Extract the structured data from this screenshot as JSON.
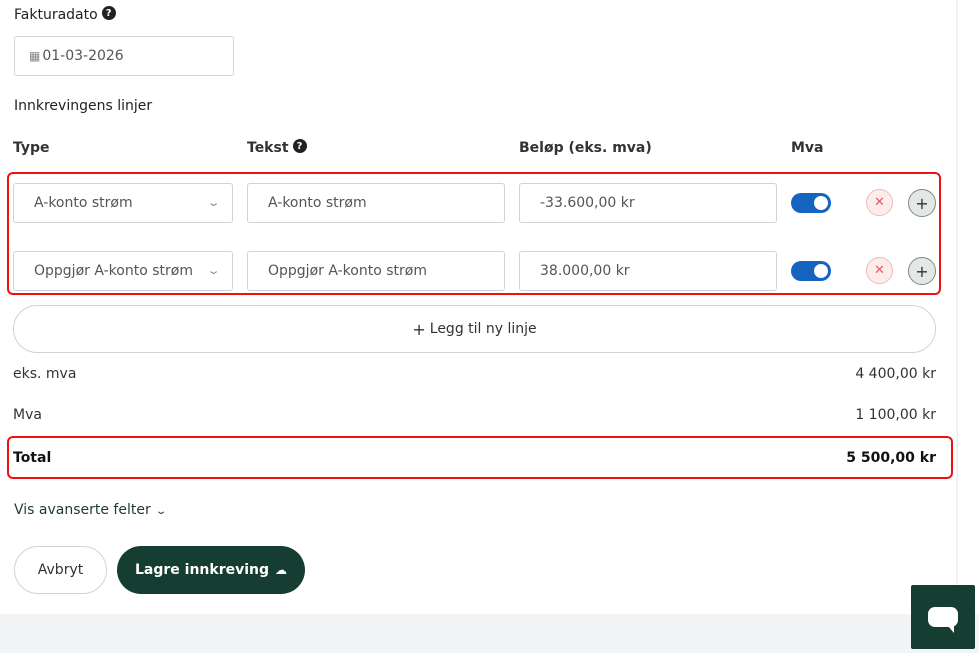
{
  "invoice_date": {
    "label": "Fakturadato",
    "value": "01-03-2026"
  },
  "lines_title": "Innkrevingens linjer",
  "columns": {
    "type": "Type",
    "text": "Tekst",
    "amount": "Beløp (eks. mva)",
    "vat": "Mva"
  },
  "lines": [
    {
      "type": "A-konto strøm",
      "text": "A-konto strøm",
      "amount": "-33.600,00 kr",
      "vat_on": true
    },
    {
      "type": "Oppgjør A-konto strøm",
      "text": "Oppgjør A-konto strøm",
      "amount": "38.000,00 kr",
      "vat_on": true
    }
  ],
  "add_line_label": "Legg til ny linje",
  "summary": {
    "ex_vat_label": "eks. mva",
    "ex_vat_value": "4 400,00 kr",
    "vat_label": "Mva",
    "vat_value": "1 100,00 kr",
    "total_label": "Total",
    "total_value": "5 500,00 kr"
  },
  "advanced_label": "Vis avanserte felter",
  "buttons": {
    "cancel": "Avbryt",
    "save": "Lagre innkreving"
  },
  "icons": {
    "help": "help-icon",
    "calendar": "calendar-icon",
    "chevron": "chevron-down-icon",
    "remove": "close-icon",
    "add": "plus-icon",
    "cloud": "cloud-upload-icon",
    "chat": "chat-icon"
  },
  "colors": {
    "primary": "#153d31",
    "toggle": "#1565c0",
    "highlight": "#e11111"
  }
}
